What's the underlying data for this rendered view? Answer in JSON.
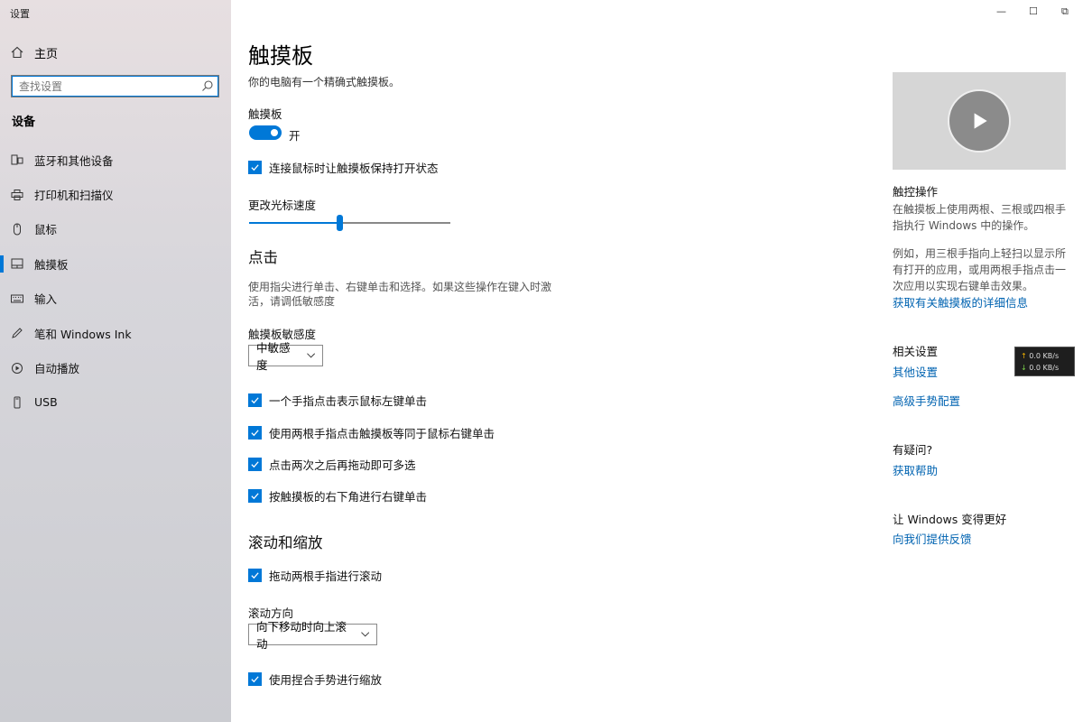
{
  "window": {
    "title": "设置",
    "controls": [
      "—",
      "☐",
      "⧉"
    ]
  },
  "sidebar": {
    "home_label": "主页",
    "search_placeholder": "查找设置",
    "section_title": "设备",
    "items": [
      {
        "label": "蓝牙和其他设备",
        "icon": "bluetooth-devices-icon"
      },
      {
        "label": "打印机和扫描仪",
        "icon": "printer-icon"
      },
      {
        "label": "鼠标",
        "icon": "mouse-icon"
      },
      {
        "label": "触摸板",
        "icon": "touchpad-icon",
        "active": true
      },
      {
        "label": "输入",
        "icon": "keyboard-icon"
      },
      {
        "label": "笔和 Windows Ink",
        "icon": "pen-icon"
      },
      {
        "label": "自动播放",
        "icon": "autoplay-icon"
      },
      {
        "label": "USB",
        "icon": "usb-icon"
      }
    ]
  },
  "main": {
    "title": "触摸板",
    "subtitle": "你的电脑有一个精确式触摸板。",
    "touchpad_label": "触摸板",
    "toggle_state": "开",
    "keep_on_with_mouse": "连接鼠标时让触摸板保持打开状态",
    "cursor_speed_label": "更改光标速度",
    "cursor_speed_fraction": 0.45,
    "taps_heading": "点击",
    "taps_desc_line1": "使用指尖进行单击、右键单击和选择。如果这些操作在键入时激",
    "taps_desc_line2": "活，请调低敏感度",
    "sensitivity_label": "触摸板敏感度",
    "sensitivity_value": "中敏感度",
    "tap_options": [
      "一个手指点击表示鼠标左键单击",
      "使用两根手指点击触摸板等同于鼠标右键单击",
      "点击两次之后再拖动即可多选",
      "按触摸板的右下角进行右键单击"
    ],
    "scroll_heading": "滚动和缩放",
    "scroll_two_fingers": "拖动两根手指进行滚动",
    "scroll_direction_label": "滚动方向",
    "scroll_direction_value": "向下移动时向上滚动",
    "pinch_zoom": "使用捏合手势进行缩放"
  },
  "right_panel": {
    "gestures_title": "触控操作",
    "gestures_text1": "在触摸板上使用两根、三根或四根手指执行 Windows 中的操作。",
    "gestures_text2": "例如，用三根手指向上轻扫以显示所有打开的应用，或用两根手指点击一次应用以实现右键单击效果。",
    "gestures_link": "获取有关触摸板的详细信息",
    "related_title": "相关设置",
    "related_link1": "其他设置",
    "related_link2": "高级手势配置",
    "question_title": "有疑问?",
    "help_link": "获取帮助",
    "improve_title": "让 Windows 变得更好",
    "feedback_link": "向我们提供反馈"
  },
  "net_widget": {
    "up_arrow": "↑",
    "up_value": "0.0 KB/s",
    "down_arrow": "↓",
    "down_value": "0.0 KB/s"
  },
  "colors": {
    "accent": "#0078d7",
    "link": "#0063b1"
  }
}
